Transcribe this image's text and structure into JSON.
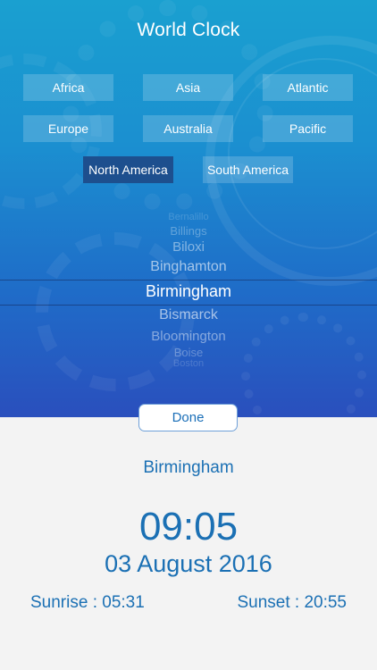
{
  "header": {
    "title": "World Clock"
  },
  "regions": [
    {
      "label": "Africa"
    },
    {
      "label": "Asia"
    },
    {
      "label": "Atlantic"
    },
    {
      "label": "Europe"
    },
    {
      "label": "Australia"
    },
    {
      "label": "Pacific"
    },
    {
      "label": "North America",
      "selected": true
    },
    {
      "label": "South America"
    }
  ],
  "picker": {
    "items": [
      "Bernalillo",
      "Billings",
      "Biloxi",
      "Binghamton",
      "Birmingham",
      "Bismarck",
      "Bloomington",
      "Boise",
      "Boston"
    ],
    "selected": "Birmingham"
  },
  "done_label": "Done",
  "result": {
    "city": "Birmingham",
    "time": "09:05",
    "date": "03 August 2016",
    "sunrise": "Sunrise : 05:31",
    "sunset": "Sunset : 20:55"
  },
  "colors": {
    "accent": "#1b70b4",
    "selected_region": "#1d4f8e"
  }
}
